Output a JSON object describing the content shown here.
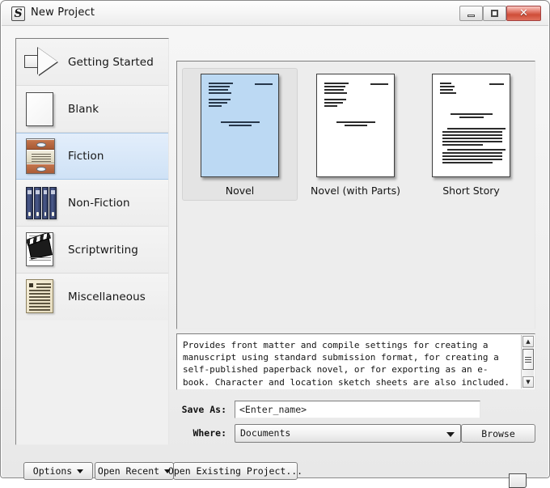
{
  "window": {
    "title": "New Project",
    "app_icon": "scrivener-s-icon",
    "controls": {
      "minimize": "minimize-icon",
      "maximize": "maximize-icon",
      "close": "✕"
    }
  },
  "sidebar": {
    "items": [
      {
        "label": "Getting Started",
        "icon": "arrow-right-icon",
        "selected": false
      },
      {
        "label": "Blank",
        "icon": "blank-page-icon",
        "selected": false
      },
      {
        "label": "Fiction",
        "icon": "fiction-books-icon",
        "selected": true
      },
      {
        "label": "Non-Fiction",
        "icon": "nonfiction-books-icon",
        "selected": false
      },
      {
        "label": "Scriptwriting",
        "icon": "clapperboard-icon",
        "selected": false
      },
      {
        "label": "Miscellaneous",
        "icon": "parchment-page-icon",
        "selected": false
      }
    ]
  },
  "templates": {
    "items": [
      {
        "label": "Novel",
        "selected": true,
        "preview": "manuscript-title-page"
      },
      {
        "label": "Novel (with Parts)",
        "selected": false,
        "preview": "manuscript-title-page"
      },
      {
        "label": "Short Story",
        "selected": false,
        "preview": "short-story-first-page"
      }
    ]
  },
  "description": {
    "text": "Provides front matter and compile settings for creating a manuscript using standard submission format, for creating a self-published paperback novel, or for exporting as an e-book. Character and location sketch sheets are also included.",
    "scroll_up_icon": "▲",
    "scroll_down_icon": "▼"
  },
  "form": {
    "save_as_label": "Save As:",
    "save_as_value": "<Enter_name>",
    "where_label": "Where:",
    "where_value": "Documents",
    "where_options": [
      "Documents"
    ],
    "browse_label": "Browse"
  },
  "bottom_bar": {
    "options_label": "Options",
    "open_recent_label": "Open Recent",
    "open_existing_label": "Open Existing Project..."
  },
  "colors": {
    "selection_blue": "#cfe2f6",
    "selection_border": "#a8c7e6",
    "thumb_selection": "#bcd9f3",
    "close_button_red": "#cf4d38",
    "window_bg": "#efefef"
  }
}
